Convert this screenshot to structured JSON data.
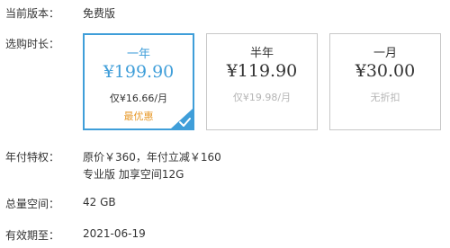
{
  "rows": {
    "current_version": {
      "label": "当前版本：",
      "value": "免费版"
    },
    "duration": {
      "label": "选购时长："
    },
    "annual_benefits": {
      "label": "年付特权：",
      "line1": "原价￥360，年付立减￥160",
      "line2": "专业版 加享空间12G"
    },
    "total_space": {
      "label": "总量空间：",
      "value": "42 GB"
    },
    "expiry": {
      "label": "有效期至：",
      "value": "2021-06-19"
    }
  },
  "plans": [
    {
      "name": "一年",
      "price": "¥199.90",
      "monthly": "仅¥16.66/月",
      "tag": "最优惠",
      "selected": true
    },
    {
      "name": "半年",
      "price": "¥119.90",
      "monthly": "仅¥19.98/月",
      "tag": "",
      "selected": false
    },
    {
      "name": "一月",
      "price": "¥30.00",
      "monthly": "无折扣",
      "tag": "",
      "selected": false
    }
  ],
  "colors": {
    "accent": "#3f9ed9",
    "tag": "#e79a2b",
    "muted": "#b5b5b5"
  },
  "icons": {
    "selected_marker": "check-icon"
  }
}
